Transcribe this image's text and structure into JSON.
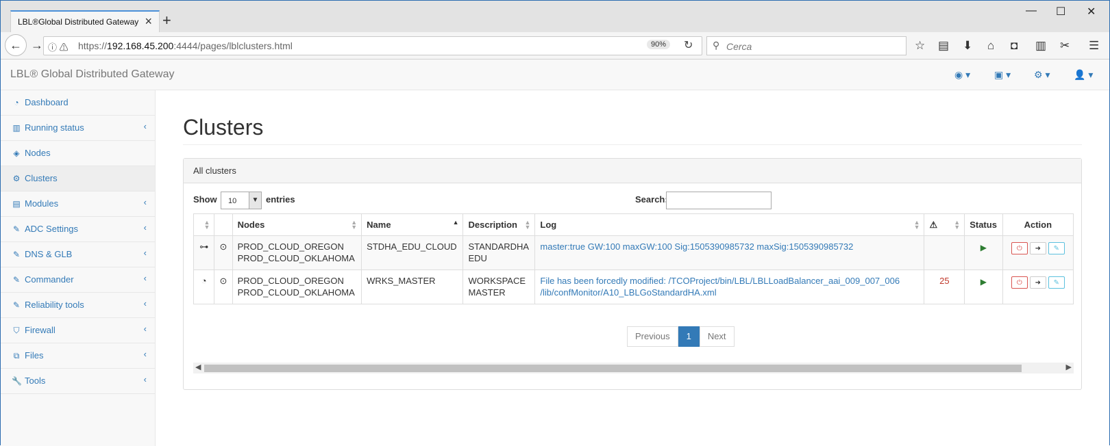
{
  "browser": {
    "tab_title": "LBL®Global Distributed Gateway",
    "url_prefix": "https://",
    "url_host": "192.168.45.200",
    "url_rest": ":4444/pages/lblclusters.html",
    "zoom": "90%",
    "search_placeholder": "Cerca"
  },
  "app": {
    "brand": "LBL® Global Distributed Gateway"
  },
  "sidebar": {
    "items": [
      {
        "label": "Dashboard",
        "icon": "dashboard-icon"
      },
      {
        "label": "Running status",
        "icon": "bar-chart-icon"
      },
      {
        "label": "Nodes",
        "icon": "cube-icon"
      },
      {
        "label": "Clusters",
        "icon": "gears-icon"
      },
      {
        "label": "Modules",
        "icon": "list-icon"
      },
      {
        "label": "ADC Settings",
        "icon": "edit-icon"
      },
      {
        "label": "DNS & GLB",
        "icon": "edit-icon"
      },
      {
        "label": "Commander",
        "icon": "edit-icon"
      },
      {
        "label": "Reliability tools",
        "icon": "edit-icon"
      },
      {
        "label": "Firewall",
        "icon": "shield-icon"
      },
      {
        "label": "Files",
        "icon": "files-icon"
      },
      {
        "label": "Tools",
        "icon": "wrench-icon"
      }
    ]
  },
  "main": {
    "title": "Clusters",
    "panel_title": "All clusters",
    "show_label": "Show",
    "page_length": "10",
    "entries_label": "entries",
    "search_label": "Search:",
    "columns": {
      "nodes": "Nodes",
      "name": "Name",
      "description": "Description",
      "log": "Log",
      "status": "Status",
      "action": "Action"
    },
    "rows": [
      {
        "nodes_1": "PROD_CLOUD_OREGON",
        "nodes_2": "PROD_CLOUD_OKLAHOMA",
        "name": "STDHA_EDU_CLOUD",
        "desc_1": "STANDARDHA",
        "desc_2": "EDU",
        "log_1": "master:true GW:100 maxGW:100 Sig:1505390985732 maxSig:1505390985732",
        "log_2": "",
        "warnings": ""
      },
      {
        "nodes_1": "PROD_CLOUD_OREGON",
        "nodes_2": "PROD_CLOUD_OKLAHOMA",
        "name": "WRKS_MASTER",
        "desc_1": "WORKSPACE",
        "desc_2": "MASTER",
        "log_1": "File has been forcedly modified: /TCOProject/bin/LBL/LBLLoadBalancer_aai_009_007_006",
        "log_2": "/lib/confMonitor/A10_LBLGoStandardHA.xml",
        "warnings": "25"
      }
    ],
    "pagination": {
      "previous": "Previous",
      "current": "1",
      "next": "Next"
    }
  }
}
